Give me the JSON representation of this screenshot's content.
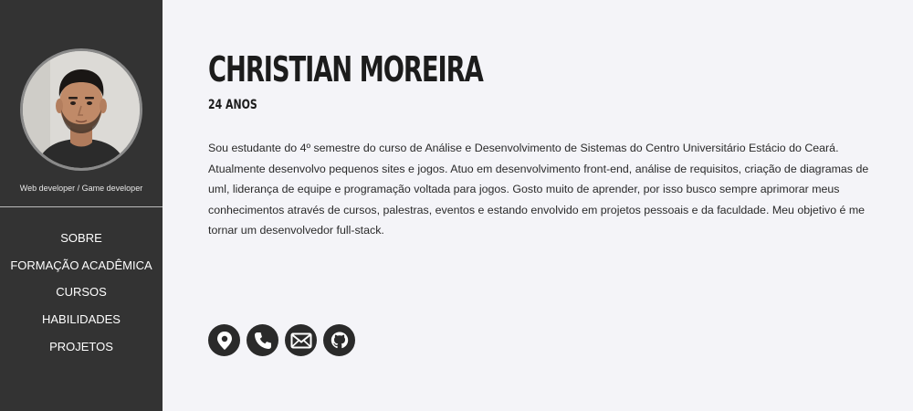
{
  "profile": {
    "role": "Web developer / Game developer",
    "name": "CHRISTIAN MOREIRA",
    "age": "24 ANOS",
    "bio": "Sou estudante do 4º semestre do curso de Análise e Desenvolvimento de Sistemas do Centro Universitário Estácio do Ceará. Atualmente desenvolvo pequenos sites e jogos. Atuo em desenvolvimento front-end, análise de requisitos, criação de diagramas de uml, liderança de equipe e programação voltada para jogos. Gosto muito de aprender, por isso busco sempre aprimorar meus conhecimentos através de cursos, palestras, eventos e estando envolvido em projetos pessoais e da faculdade. Meu objetivo é me tornar um desenvolvedor full-stack."
  },
  "nav": {
    "items": [
      {
        "label": "SOBRE"
      },
      {
        "label": "FORMAÇÃO ACADÊMICA"
      },
      {
        "label": "CURSOS"
      },
      {
        "label": "HABILIDADES"
      },
      {
        "label": "PROJETOS"
      }
    ]
  },
  "contacts": {
    "icons": [
      "location-pin-icon",
      "phone-icon",
      "email-icon",
      "github-icon"
    ]
  },
  "colors": {
    "sidebar_bg": "#333333",
    "page_bg": "#f4f4f8",
    "icon_bg": "#2a2a2a"
  }
}
